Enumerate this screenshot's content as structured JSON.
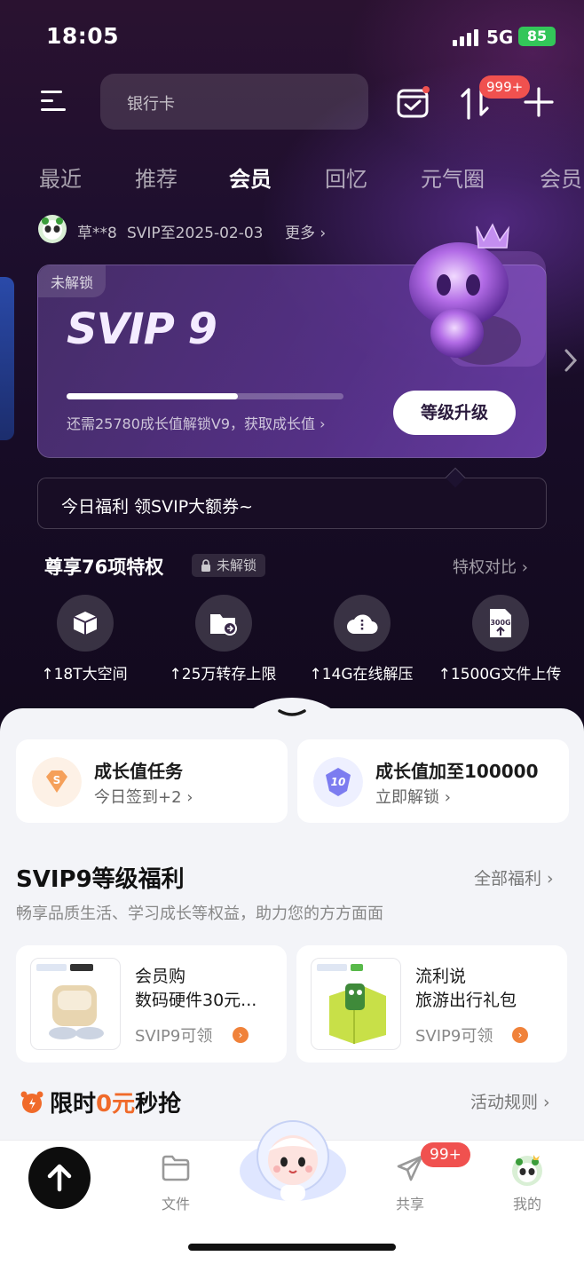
{
  "status_bar": {
    "time": "18:05",
    "network": "5G",
    "battery": "85"
  },
  "header": {
    "search_placeholder": "银行卡",
    "notification_badge": "999+"
  },
  "tabs": [
    "最近",
    "推荐",
    "会员",
    "回忆",
    "元气圈",
    "会员"
  ],
  "active_tab": "会员",
  "user": {
    "name": "草**8",
    "expire": "SVIP至2025-02-03",
    "more": "更多"
  },
  "svip_card": {
    "lock_tag": "未解锁",
    "level": "SVIP 9",
    "progress": 0.62,
    "hint": "还需25780成长值解锁V9，获取成长值",
    "upgrade_label": "等级升级"
  },
  "welfare_banner": "今日福利 领SVIP大额券~",
  "privileges": {
    "title": "尊享76项特权",
    "lock_label": "未解锁",
    "compare_label": "特权对比",
    "items": [
      {
        "label": "18T大空间",
        "icon": "box-icon"
      },
      {
        "label": "25万转存上限",
        "icon": "folder-transfer-icon"
      },
      {
        "label": "14G在线解压",
        "icon": "cloud-zip-icon"
      },
      {
        "label": "1500G文件上传",
        "icon": "upload-300g-icon"
      }
    ]
  },
  "tasks": [
    {
      "title": "成长值任务",
      "sub": "今日签到+2",
      "icon": "growth-s-icon"
    },
    {
      "title": "成长值加至100000",
      "sub": "立即解锁",
      "icon": "level-10-icon"
    }
  ],
  "benefits_section": {
    "title": "SVIP9等级福利",
    "link": "全部福利",
    "subtitle": "畅享品质生活、学习成长等权益，助力您的方方面面"
  },
  "gifts": [
    {
      "line1": "会员购",
      "line2": "数码硬件30元...",
      "claim": "SVIP9可领"
    },
    {
      "line1": "流利说",
      "line2": "旅游出行礼包",
      "claim": "SVIP9可领"
    }
  ],
  "flash_sale": {
    "prefix": "限时",
    "highlight": "0元",
    "suffix": "秒抢",
    "rules": "活动规则"
  },
  "bottom_nav": {
    "items": [
      "文件",
      "共享",
      "我的"
    ],
    "share_badge": "99+"
  },
  "colors": {
    "accent_red": "#f0514f",
    "orange": "#f0823a",
    "brand_dark": "#170c26"
  }
}
